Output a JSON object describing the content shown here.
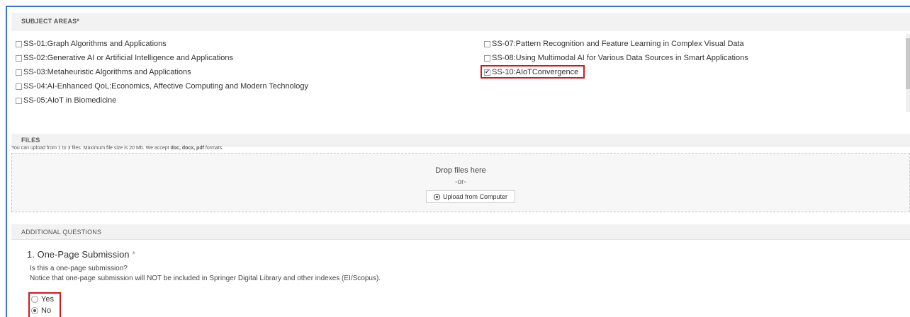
{
  "subject_areas": {
    "header": "SUBJECT AREAS*",
    "left_items": [
      {
        "label": "SS-01:Graph Algorithms and Applications",
        "checked": false
      },
      {
        "label": "SS-02:Generative AI or Artificial Intelligence and Applications",
        "checked": false
      },
      {
        "label": "SS-03:Metaheuristic Algorithms and Applications",
        "checked": false
      },
      {
        "label": "SS-04:AI-Enhanced QoL:Economics, Affective Computing and Modern Technology",
        "checked": false
      },
      {
        "label": "SS-05:AIoT in Biomedicine",
        "checked": false
      }
    ],
    "right_items": [
      {
        "label": "SS-07:Pattern Recognition and Feature Learning in Complex Visual Data",
        "checked": false
      },
      {
        "label": "SS-08:Using Multimodal AI for Various Data Sources in Smart Applications",
        "checked": false
      },
      {
        "label": "SS-10:AIoTConvergence",
        "checked": true
      }
    ]
  },
  "files": {
    "header": "FILES",
    "note_prefix": "You can upload from 1 to 3 files. Maximum file size is 20 Mb. We accept ",
    "note_formats": "doc, docx, pdf",
    "note_suffix": " formats.",
    "drop_text": "Drop files here",
    "or_text": "-or-",
    "upload_label": "Upload from Computer"
  },
  "additional_questions": {
    "header": "ADDITIONAL QUESTIONS",
    "question_title": "1. One-Page Submission",
    "required_mark": "*",
    "help_line1": "Is this a one-page submission?",
    "help_line2": "Notice that one-page submission will NOT be included in Springer Digital Library and other indexes (EI/Scopus).",
    "options": [
      {
        "label": "Yes",
        "selected": false
      },
      {
        "label": "No",
        "selected": true
      }
    ]
  },
  "colors": {
    "frame_border": "#3b78c4",
    "highlight_border": "#d0191f",
    "header_bg": "#f2f2f2"
  }
}
